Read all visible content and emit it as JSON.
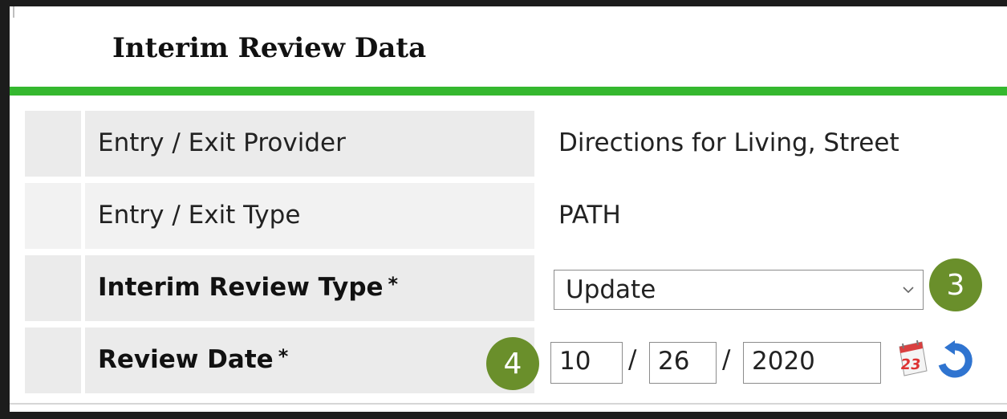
{
  "section": {
    "title": "Interim Review Data"
  },
  "rows": [
    {
      "label": "Entry / Exit Provider",
      "value": "Directions for Living, Street"
    },
    {
      "label": "Entry / Exit Type",
      "value": "PATH"
    },
    {
      "label": "Interim Review Type",
      "required_mark": "*",
      "select_value": "Update"
    },
    {
      "label": "Review Date",
      "required_mark": "*",
      "date": {
        "month": "10",
        "day": "26",
        "year": "2020",
        "separator": "/"
      }
    }
  ],
  "badges": {
    "step3": "3",
    "step4": "4"
  },
  "icons": {
    "calendar": "calendar-icon",
    "refresh": "refresh-icon",
    "dropdown": "chevron-down-icon"
  },
  "colors": {
    "accent_green": "#35b82f",
    "badge_green": "#6a8f2b",
    "cell_bg": "#ebebeb"
  }
}
